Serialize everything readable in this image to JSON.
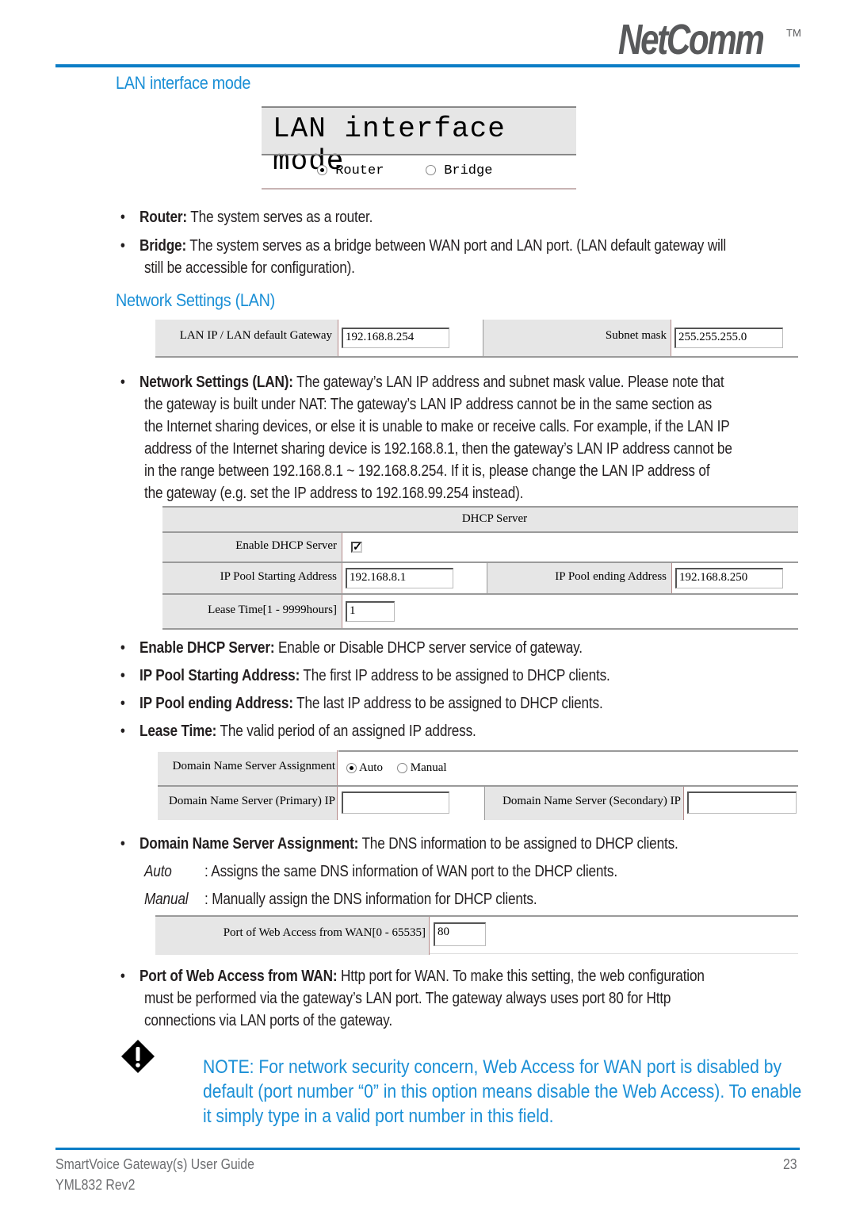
{
  "header": {
    "logo": "NetComm",
    "trademark": "TM",
    "accent_color": "#0c7dc6"
  },
  "sections": {
    "lan_mode_heading": "LAN interface mode",
    "network_settings_heading": "Network Settings (LAN)"
  },
  "lan_mode_ui": {
    "title": "LAN interface mode",
    "options": [
      {
        "label": "Router",
        "selected": true
      },
      {
        "label": "Bridge",
        "selected": false
      }
    ]
  },
  "lan_mode_bullets": [
    {
      "term": "Router:",
      "text": " The system serves as a router."
    },
    {
      "term": "Bridge:",
      "text": " The system serves as a bridge between WAN port and LAN port. (LAN default gateway will",
      "text2": "still be accessible for configuration)."
    }
  ],
  "network_ui": {
    "lan_ip_label": "LAN IP / LAN default Gateway",
    "lan_ip_value": "192.168.8.254",
    "subnet_label": "Subnet mask",
    "subnet_value": "255.255.255.0"
  },
  "network_bullet": {
    "term": "Network Settings (LAN):",
    "lines": [
      " The gateway’s LAN IP address and subnet mask value. Please note that",
      "the gateway is built under NAT: The gateway’s LAN IP address cannot be in the same section as",
      "the Internet sharing devices, or else it is unable to make or receive calls. For example, if the LAN IP",
      "address of the Internet sharing device is 192.168.8.1, then the gateway’s LAN IP address cannot be",
      "in the range between 192.168.8.1 ~ 192.168.8.254. If it is, please change the LAN IP address of",
      "the gateway (e.g. set the IP address to 192.168.99.254 instead)."
    ]
  },
  "dhcp_ui": {
    "title": "DHCP Server",
    "enable_label": "Enable DHCP Server",
    "enable_checked": true,
    "enable_mark": "✓",
    "pool_start_label": "IP Pool Starting Address",
    "pool_start_value": "192.168.8.1",
    "pool_end_label": "IP Pool ending Address",
    "pool_end_value": "192.168.8.250",
    "lease_label": "Lease Time[1 - 9999hours]",
    "lease_value": "1"
  },
  "dhcp_bullets": [
    {
      "term": "Enable DHCP Server:",
      "text": " Enable or Disable DHCP server service of gateway."
    },
    {
      "term": "IP Pool Starting Address:",
      "text": " The first IP address to be assigned to DHCP clients."
    },
    {
      "term": "IP Pool ending Address:",
      "text": " The last IP address to be assigned to DHCP clients."
    },
    {
      "term": "Lease Time:",
      "text": " The valid period of an assigned IP address."
    }
  ],
  "dns_ui": {
    "assignment_label": "Domain Name Server Assignment",
    "options": [
      {
        "label": "Auto",
        "selected": true
      },
      {
        "label": "Manual",
        "selected": false
      }
    ],
    "primary_label": "Domain Name Server (Primary) IP",
    "primary_value": "",
    "secondary_label": "Domain Name Server (Secondary) IP",
    "secondary_value": ""
  },
  "dns_bullet": {
    "term": "Domain Name Server Assignment:",
    "text": " The DNS information to be assigned to DHCP clients.",
    "auto_term": "Auto",
    "auto_text": ": Assigns the same DNS information of WAN port to the DHCP clients.",
    "manual_term": "Manual",
    "manual_text": ": Manually assign the DNS information for DHCP clients."
  },
  "web_port_ui": {
    "label": "Port of Web Access from WAN[0 - 65535]",
    "value": "80"
  },
  "web_port_bullet": {
    "term": "Port of Web Access from WAN:",
    "lines": [
      " Http port for WAN. To make this setting, the web configuration",
      "must be performed via the gateway’s LAN port. The gateway always uses port 80 for Http",
      "connections via LAN ports of the gateway."
    ]
  },
  "note": {
    "icon": "warning-icon",
    "lines": [
      "NOTE: For network security concern, Web Access for WAN port is disabled by",
      "default (port number “0” in this option means disable the Web Access). To enable",
      "it simply type in a valid port number in this field."
    ]
  },
  "footer": {
    "guide_title": "SmartVoice Gateway(s) User Guide",
    "revision": "YML832 Rev2",
    "page_number": "23"
  }
}
